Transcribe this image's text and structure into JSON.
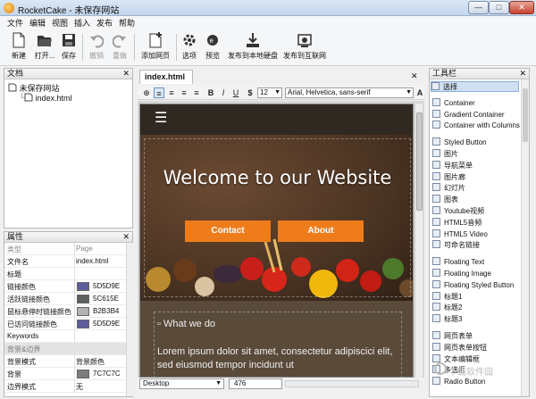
{
  "window": {
    "title": "RocketCake - 未保存网站",
    "min_glyph": "—",
    "max_glyph": "□",
    "close_glyph": "✕"
  },
  "menu": [
    "文件",
    "编辑",
    "视图",
    "插入",
    "发布",
    "帮助"
  ],
  "toolbar": {
    "new": "新建",
    "open": "打开...",
    "save": "保存",
    "undo": "撤销",
    "redo": "重做",
    "add_page": "添加网页",
    "options": "选项",
    "preview": "预览",
    "publish_local": "发布到本地硬盘",
    "publish_web": "发布到互联网"
  },
  "documents": {
    "title": "文档",
    "close": "✕",
    "root": "未保存网站",
    "page": "index.html"
  },
  "properties": {
    "title": "属性",
    "close": "✕",
    "rows": [
      {
        "key": "类型",
        "value": "Page",
        "dim": true
      },
      {
        "key": "文件名",
        "value": "index.html"
      },
      {
        "key": "标题",
        "value": ""
      },
      {
        "key": "链接颜色",
        "value": "5D5D9E",
        "color": "#5D5D9E"
      },
      {
        "key": "活跃链接颜色",
        "value": "5C615E",
        "color": "#5C615E"
      },
      {
        "key": "鼠标悬停时链接颜色",
        "value": "B2B3B4",
        "color": "#B2B3B4"
      },
      {
        "key": "已访问链接颜色",
        "value": "5D5D9E",
        "color": "#5D5D9E"
      },
      {
        "key": "Keywords",
        "value": ""
      },
      {
        "key": "背景&边界",
        "value": "",
        "header": true
      },
      {
        "key": "背景模式",
        "value": "背景颜色"
      },
      {
        "key": "背景",
        "value": "7C7C7C",
        "color": "#7C7C7C"
      },
      {
        "key": "边界模式",
        "value": "无"
      }
    ]
  },
  "editor": {
    "tab": "index.html",
    "tab_close": "✕",
    "font_size": "12",
    "font_family": "Arial, Helvetica, sans-serif",
    "viewport": "Desktop",
    "width": "476"
  },
  "website": {
    "menu_glyph": "☰",
    "hero_title": "Welcome to our Website",
    "btn_contact": "Contact",
    "btn_about": "About",
    "section_heading": "What we do",
    "body_text": "Lorem ipsum dolor sit amet, consectetur adipiscici elit, sed eiusmod tempor incidunt ut"
  },
  "tools": {
    "title": "工具栏",
    "close": "✕",
    "groups": [
      [
        "选择"
      ],
      [
        "Container",
        "Gradient Container",
        "Container with Columns"
      ],
      [
        "Styled Button",
        "图片",
        "导航菜单",
        "图片廊",
        "幻灯片",
        "图表",
        "Youtube视频",
        "HTML5音频",
        "HTML5 Video",
        "可命名链接"
      ],
      [
        "Floating Text",
        "Floating Image",
        "Floating Styled Button",
        "标题1",
        "标题2",
        "标题3"
      ],
      [
        "网页表单",
        "网页表单按钮",
        "文本编辑框",
        "多选框",
        "Radio Button"
      ]
    ]
  },
  "watermark": "下载软件园"
}
